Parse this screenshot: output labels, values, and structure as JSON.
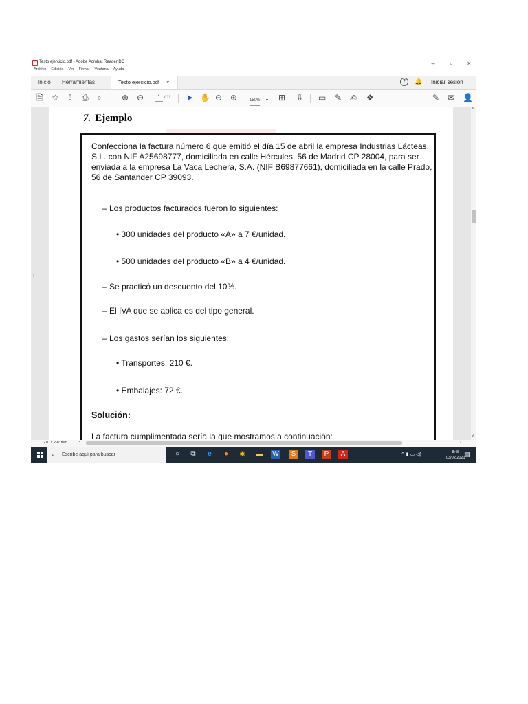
{
  "window": {
    "title": "Testo ejercicio.pdf - Adobe Acrobat Reader DC",
    "menu": [
      "Archivo",
      "Edición",
      "Ver",
      "Firmar",
      "Ventana",
      "Ayuda"
    ],
    "controls": {
      "minimize": "–",
      "maximize": "▫",
      "close": "×"
    }
  },
  "tabs": {
    "home": "Inicio",
    "tools": "Herramientas",
    "document": "Testo ejercicio.pdf",
    "close": "×",
    "help": "?",
    "signin": "Iniciar sesión"
  },
  "toolbar": {
    "page_current": "4",
    "page_total": "/ 11",
    "zoom": "150%"
  },
  "document": {
    "section_number": "7.",
    "section_title": "Ejemplo",
    "intro": "Confecciona la factura número 6 que emitió el día 15 de abril la empresa Industrias Lácteas, S.L. con NIF A25698777, domiciliada en calle Hércules, 56 de Madrid CP 28004, para ser enviada a la empresa La Vaca Lechera, S.A. (NIF B69877661), domiciliada en la calle Prado, 56 de Santander CP 39093.",
    "products_heading": "– Los productos facturados fueron lo siguientes:",
    "product_a": "• 300 unidades del producto «A» a 7 €/unidad.",
    "product_b": "• 500 unidades del producto «B» a 4 €/unidad.",
    "discount": "– Se practicó un descuento del 10%.",
    "iva": "– El IVA que se aplica es del tipo general.",
    "expenses_heading": "– Los gastos serían los siguientes:",
    "transport": "• Transportes: 210 €.",
    "packaging": "• Embalajes: 72 €.",
    "solution_label": "Solución:",
    "solution_text": "La factura cumplimentada sería la que mostramos a continuación:"
  },
  "status": {
    "page_size": "210 x 297 mm"
  },
  "taskbar": {
    "search_placeholder": "Escribe aquí para buscar",
    "time": "8:48",
    "date": "03/02/2021"
  }
}
